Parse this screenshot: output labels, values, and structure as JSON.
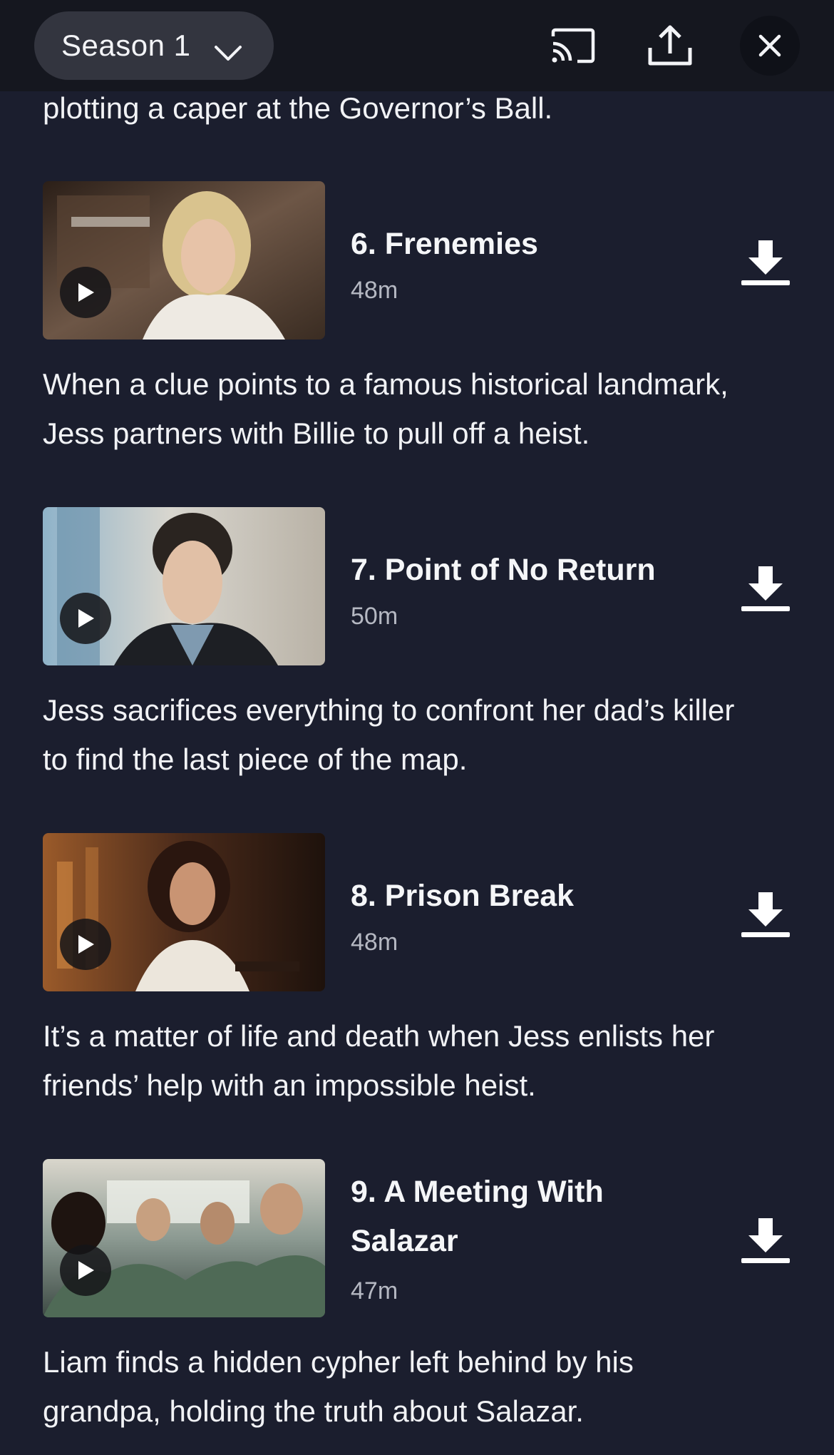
{
  "header": {
    "season_label": "Season 1",
    "icons": [
      "chevron-down-icon",
      "cast-icon",
      "share-icon",
      "close-icon"
    ]
  },
  "intro": {
    "text": "plotting a caper at the Governor’s Ball."
  },
  "episodes": [
    {
      "title": "6. Frenemies",
      "duration": "48m",
      "description_line1": "When a clue points to a famous historical landmark,",
      "description_line2": "Jess partners with Billie to pull off a heist."
    },
    {
      "title": "7. Point of No Return",
      "duration": "50m",
      "description_line1": "Jess sacrifices everything to confront her dad’s killer",
      "description_line2": "to find the last piece of the map."
    },
    {
      "title": "8. Prison Break",
      "duration": "48m",
      "description_line1": "It’s a matter of life and death when Jess enlists her",
      "description_line2": "friends’ help with an impossible heist."
    },
    {
      "title_line1": "9. A Meeting With",
      "title_line2": "Salazar",
      "duration": "47m",
      "description_line1": "Liam finds a hidden cypher left behind by his",
      "description_line2": "grandpa, holding the truth about Salazar."
    }
  ],
  "colors": {
    "background": "#1b1e2e",
    "topbar": "#15171f",
    "text": "#f3f4f7",
    "secondary_text": "#b5b8c2"
  }
}
